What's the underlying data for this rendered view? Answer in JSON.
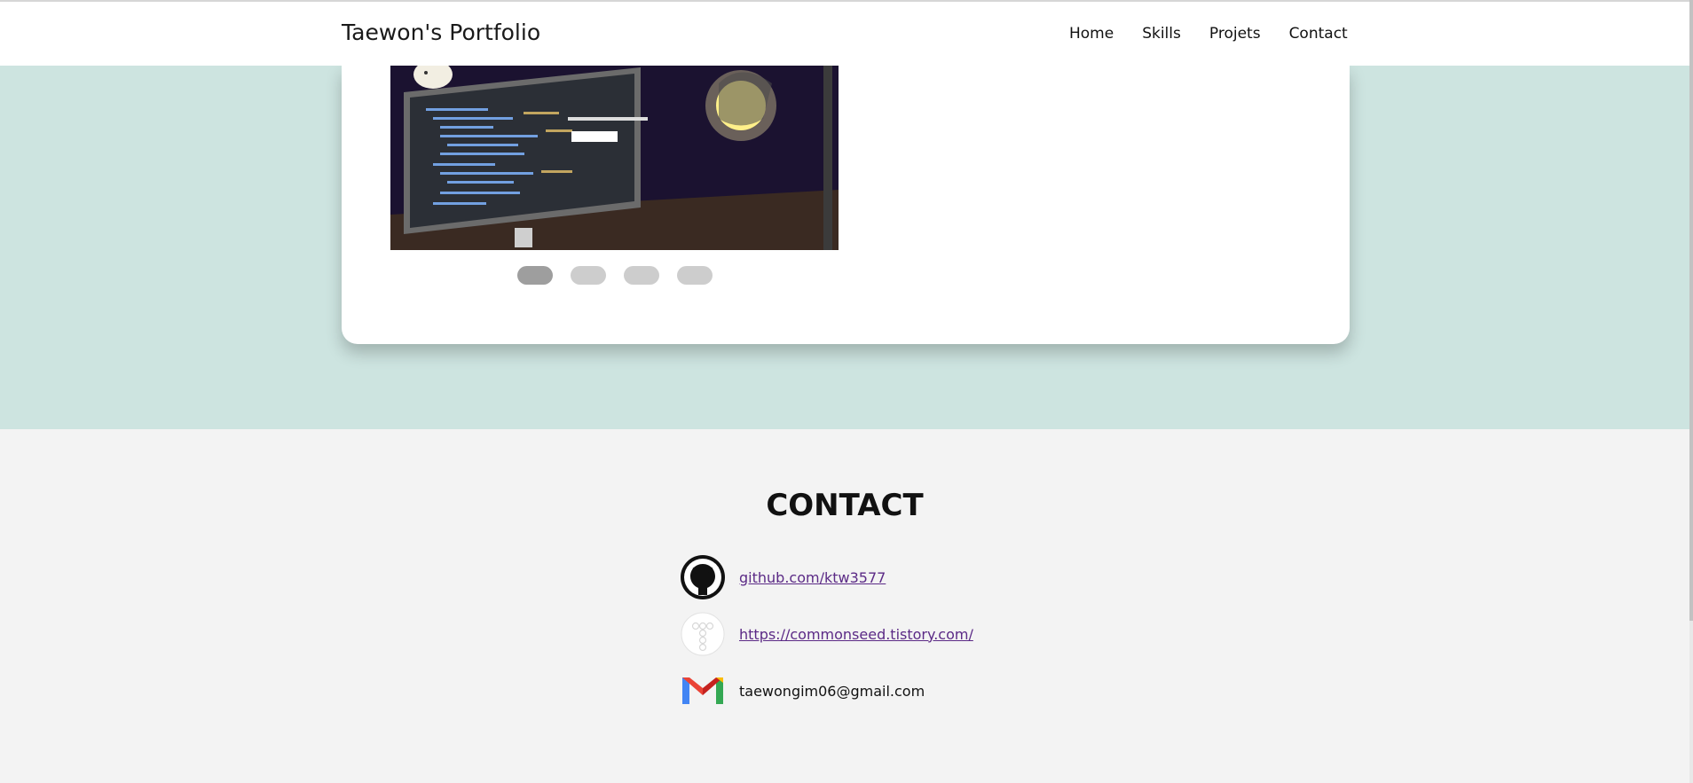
{
  "header": {
    "brand": "Taewon's Portfolio",
    "nav": [
      "Home",
      "Skills",
      "Projets",
      "Contact"
    ]
  },
  "projects": {
    "carousel": {
      "slide_count": 4,
      "active_index": 0
    }
  },
  "contact": {
    "title": "CONTACT",
    "items": [
      {
        "icon": "github-icon",
        "label": "github.com/ktw3577",
        "is_link": true
      },
      {
        "icon": "tistory-icon",
        "label": "https://commonseed.tistory.com/",
        "is_link": true
      },
      {
        "icon": "gmail-icon",
        "label": "taewongim06@gmail.com",
        "is_link": false
      }
    ]
  },
  "colors": {
    "band": "#cde4e0",
    "contact_bg": "#f3f3f3",
    "link": "#5b2a86",
    "dot_active": "#9e9e9e",
    "dot_inactive": "#cdcdcd"
  }
}
